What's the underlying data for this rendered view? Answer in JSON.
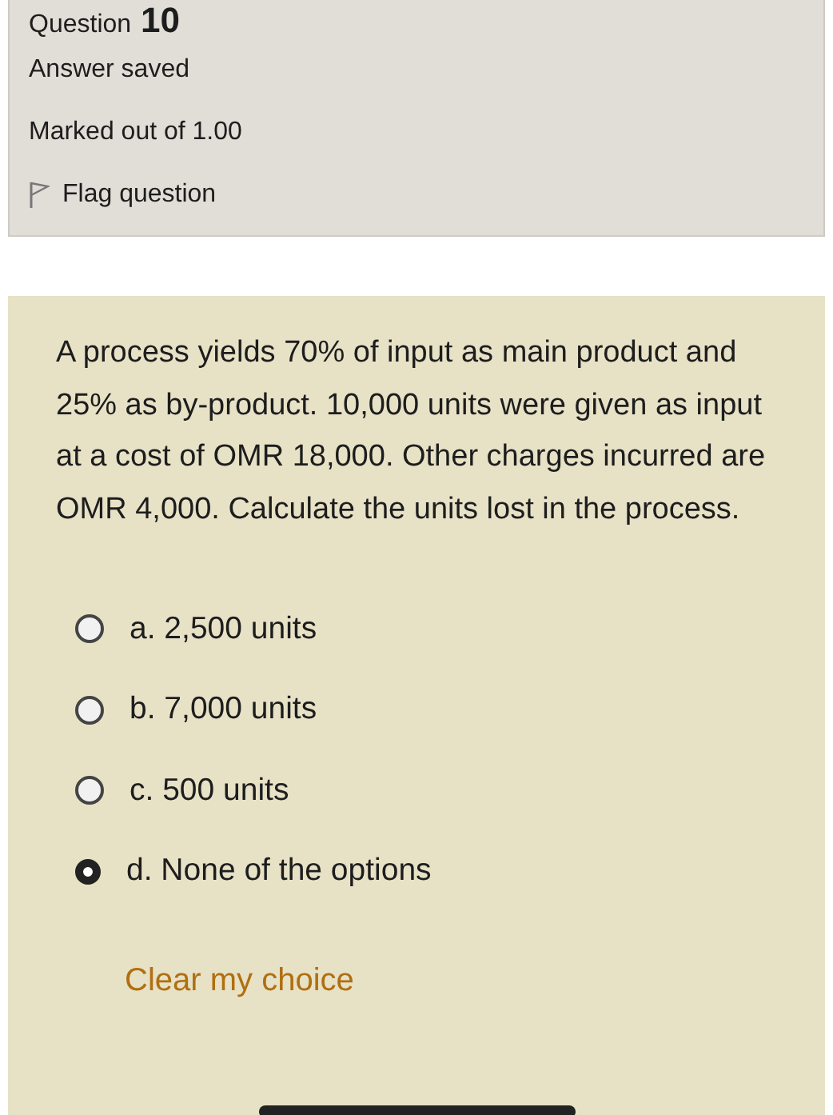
{
  "info": {
    "question_label": "Question",
    "question_number": "10",
    "status": "Answer saved",
    "marks": "Marked out of 1.00",
    "flag": {
      "label": "Flag question",
      "flagged": false
    }
  },
  "question": {
    "text": "A process yields 70% of input as main product and 25% as by-product. 10,000 units were given as input at a cost of OMR 18,000. Other charges incurred are OMR 4,000. Calculate the units lost in the process.",
    "options": [
      {
        "label": "a. 2,500 units",
        "selected": false
      },
      {
        "label": "b. 7,000 units",
        "selected": false
      },
      {
        "label": "c. 500 units",
        "selected": false
      },
      {
        "label": "d. None of the options",
        "selected": true
      }
    ],
    "clear_link": "Clear my choice"
  }
}
